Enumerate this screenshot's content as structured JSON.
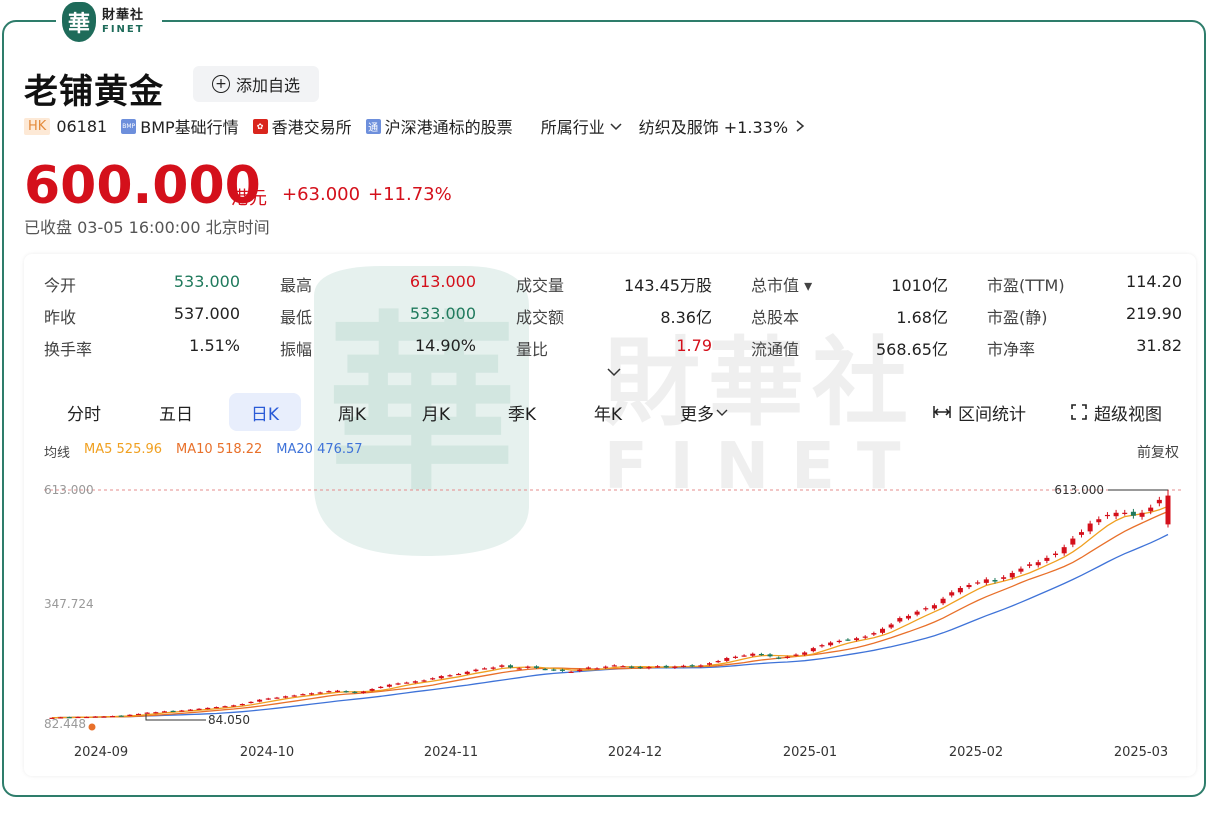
{
  "brand": {
    "logo_char": "華",
    "name_cn": "財華社",
    "name_en": "FINET"
  },
  "stock": {
    "name": "老铺黄金",
    "watch_label": "添加自选",
    "market": "HK",
    "code": "06181",
    "tag_bmp": "BMP基础行情",
    "tag_exchange": "香港交易所",
    "tag_connect": "沪深港通标的股票",
    "industry_label": "所属行业",
    "sector": "纺织及服饰 +1.33%"
  },
  "quote": {
    "price": "600.000",
    "currency": "港元",
    "change": "+63.000",
    "change_pct": "+11.73%",
    "status": "已收盘 03-05 16:00:00 北京时间"
  },
  "stats": [
    [
      {
        "label": "今开",
        "value": "533.000",
        "color": "green"
      },
      {
        "label": "最高",
        "value": "613.000",
        "color": "red"
      },
      {
        "label": "成交量",
        "value": "143.45万股"
      },
      {
        "label": "总市值 ▾",
        "value": "1010亿"
      },
      {
        "label": "市盈(TTM)",
        "value": "114.20"
      }
    ],
    [
      {
        "label": "昨收",
        "value": "537.000"
      },
      {
        "label": "最低",
        "value": "533.000",
        "color": "green"
      },
      {
        "label": "成交额",
        "value": "8.36亿"
      },
      {
        "label": "总股本",
        "value": "1.68亿"
      },
      {
        "label": "市盈(静)",
        "value": "219.90"
      }
    ],
    [
      {
        "label": "换手率",
        "value": "1.51%"
      },
      {
        "label": "振幅",
        "value": "14.90%"
      },
      {
        "label": "量比",
        "value": "1.79",
        "color": "red"
      },
      {
        "label": "流通值",
        "value": "568.65亿"
      },
      {
        "label": "市净率",
        "value": "31.82"
      }
    ]
  ],
  "expand_icon": "chevron-down",
  "tabs": [
    "分时",
    "五日",
    "日K",
    "周K",
    "月K",
    "季K",
    "年K",
    "更多"
  ],
  "active_tab": "日K",
  "tools": {
    "range_stats": "区间统计",
    "super_view": "超级视图"
  },
  "ma": {
    "label": "均线",
    "ma5": "MA5 525.96",
    "ma10": "MA10 518.22",
    "ma20": "MA20 476.57",
    "adjust": "前复权"
  },
  "colors": {
    "up": "#d4101b",
    "down": "#1f7a5c",
    "accent": "#2a5bd7",
    "ma5": "#f0a020",
    "ma10": "#e8702a",
    "ma20": "#3f73d8"
  },
  "chart_data": {
    "type": "candlestick",
    "x_ticks": [
      "2024-09",
      "2024-10",
      "2024-11",
      "2024-12",
      "2025-01",
      "2025-02",
      "2025-03"
    ],
    "y_ticks": [
      "613.000",
      "347.724",
      "82.448"
    ],
    "ylim": [
      82.448,
      613.0
    ],
    "annotations": {
      "high_label": "613.000",
      "low_label": "84.050"
    },
    "series": [
      {
        "name": "MA5"
      },
      {
        "name": "MA10"
      },
      {
        "name": "MA20"
      }
    ],
    "candles_close": [
      83,
      84,
      84,
      85,
      85,
      86,
      86,
      87,
      88,
      90,
      92,
      95,
      96,
      98,
      99,
      100,
      102,
      104,
      106,
      108,
      110,
      112,
      115,
      120,
      125,
      128,
      130,
      133,
      135,
      138,
      140,
      142,
      145,
      146,
      143,
      141,
      144,
      150,
      155,
      160,
      163,
      165,
      168,
      170,
      175,
      180,
      182,
      185,
      190,
      195,
      198,
      200,
      205,
      200,
      198,
      202,
      199,
      196,
      194,
      192,
      190,
      195,
      200,
      198,
      202,
      205,
      203,
      200,
      199,
      201,
      203,
      200,
      202,
      204,
      203,
      205,
      210,
      215,
      222,
      225,
      228,
      232,
      230,
      226,
      222,
      225,
      230,
      235,
      245,
      252,
      258,
      262,
      265,
      268,
      272,
      280,
      290,
      300,
      315,
      320,
      330,
      338,
      345,
      360,
      375,
      385,
      392,
      398,
      405,
      400,
      410,
      420,
      430,
      440,
      445,
      455,
      465,
      480,
      500,
      515,
      535,
      545,
      555,
      560,
      560,
      553,
      560,
      572,
      590,
      600
    ]
  }
}
